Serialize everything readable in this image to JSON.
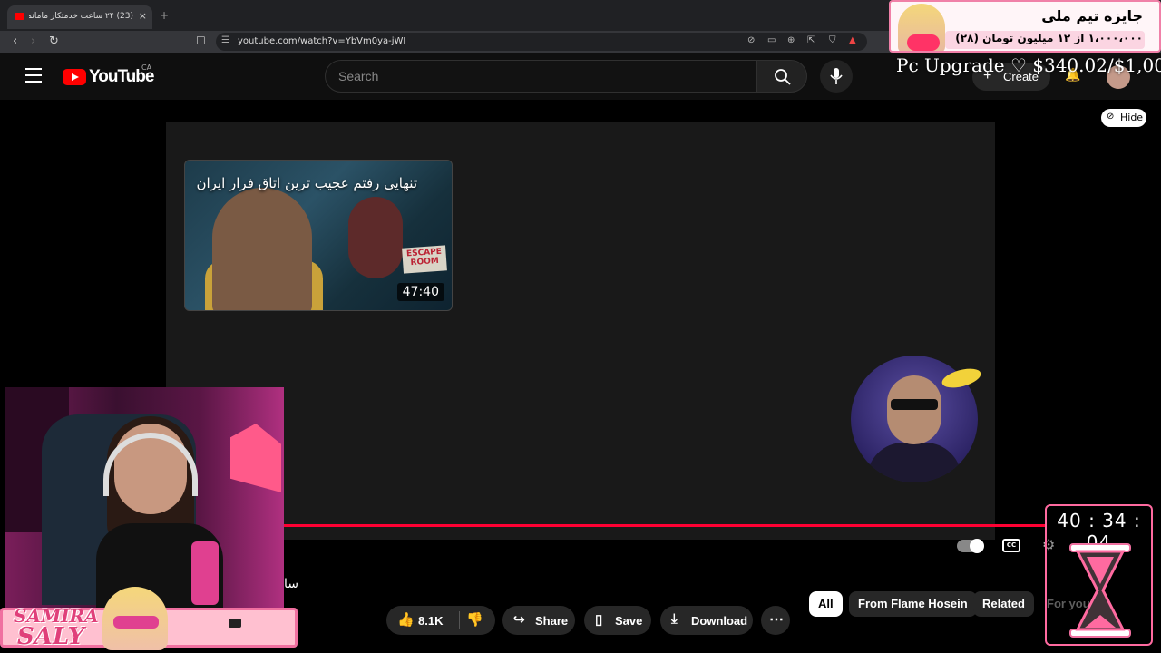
{
  "browser": {
    "tab_title": "(23) ۲۴ ساعت خدمتکار مامانم شد...",
    "tab_close": "×",
    "new_tab": "+",
    "url": "youtube.com/watch?v=YbVm0ya-jWI"
  },
  "youtube": {
    "logo": "YouTube",
    "country": "CA",
    "search_placeholder": "Search",
    "create_label": "Create"
  },
  "video": {
    "endcard_title": "تنهایی رفتم عجیب ترین اتاق فرار ایران",
    "endcard_duration": "47:40",
    "endcard_badge": "ESCAPE ROOM",
    "hide_label": "Hide",
    "title_fragment": "سا",
    "cc_label": "CC"
  },
  "actions": {
    "like_count": "8.1K",
    "share": "Share",
    "save": "Save",
    "download": "Download",
    "more": "⋯"
  },
  "chips": [
    "All",
    "From Flame Hosein",
    "Related",
    "For you"
  ],
  "overlays": {
    "donation_title": "جایزه تیم ملی",
    "donation_progress": "۱،۰۰۰،۰۰۰ از ۱۲ میلیون تومان (۲۸)",
    "goal_text": "Pc Upgrade ♡ $340.02/$1,000",
    "streamer_name_1": "SAMIRA",
    "streamer_name_2": "SALY",
    "timer": "40 : 34 : 04"
  },
  "colors": {
    "accent": "#ff0033",
    "overlay_pink": "#f070a0"
  }
}
